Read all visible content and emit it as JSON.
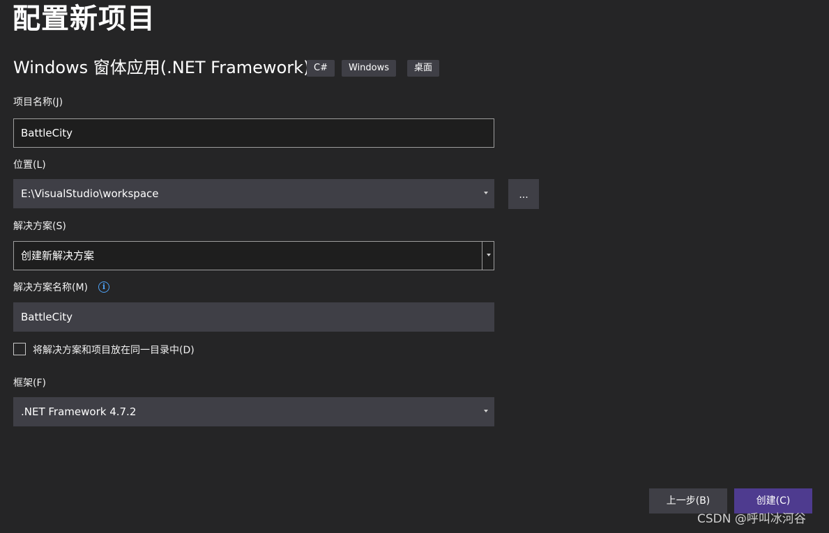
{
  "page": {
    "title": "配置新项目"
  },
  "template": {
    "name": "Windows 窗体应用(.NET Framework)",
    "tags": [
      "C#",
      "Windows",
      "桌面"
    ]
  },
  "fields": {
    "project_name": {
      "label": "项目名称(J)",
      "value": "BattleCity"
    },
    "location": {
      "label": "位置(L)",
      "value": "E:\\VisualStudio\\workspace",
      "browse_label": "..."
    },
    "solution": {
      "label": "解决方案(S)",
      "value": "创建新解决方案"
    },
    "solution_name": {
      "label": "解决方案名称(M)",
      "value": "BattleCity",
      "info_icon": "info-icon"
    },
    "same_directory": {
      "label": "将解决方案和项目放在同一目录中(D)",
      "checked": false
    },
    "framework": {
      "label": "框架(F)",
      "value": ".NET Framework 4.7.2"
    }
  },
  "actions": {
    "back_label": "上一步(B)",
    "create_label": "创建(C)"
  },
  "watermark": "CSDN @呼叫冰河谷",
  "colors": {
    "background": "#252526",
    "input_filled": "#3f3f46",
    "input_outlined_bg": "#1e1e1e",
    "primary_button": "#4e3b8f",
    "info_accent": "#4fa3f7"
  }
}
